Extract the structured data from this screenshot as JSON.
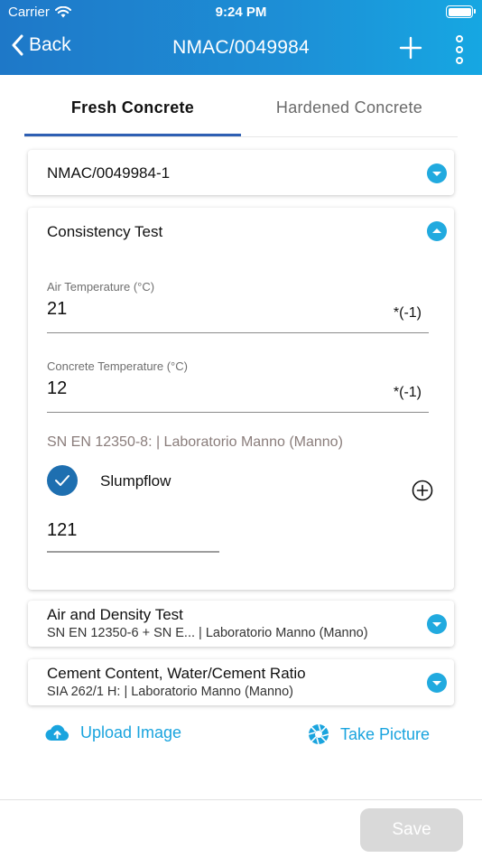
{
  "status_bar": {
    "carrier": "Carrier",
    "time": "9:24 PM"
  },
  "nav": {
    "back_label": "Back",
    "title": "NMAC/0049984"
  },
  "tabs": [
    {
      "label": "Fresh Concrete",
      "active": true
    },
    {
      "label": "Hardened Concrete",
      "active": false
    }
  ],
  "sample": {
    "label": "NMAC/0049984-1"
  },
  "consistency": {
    "title": "Consistency Test",
    "air_temp": {
      "label": "Air Temperature (°C)",
      "value": "21",
      "suffix": "*(-1)"
    },
    "concrete_temp": {
      "label": "Concrete Temperature (°C)",
      "value": "12",
      "suffix": "*(-1)"
    },
    "standard": "SN EN 12350-8: | Laboratorio Manno (Manno)",
    "slumpflow": {
      "label": "Slumpflow",
      "checked": true,
      "value": "121"
    }
  },
  "air_density": {
    "title": "Air and Density Test",
    "subtitle": "SN EN 12350-6 + SN E...  | Laboratorio Manno (Manno)"
  },
  "cement": {
    "title": "Cement Content, Water/Cement Ratio",
    "subtitle": "SIA 262/1 H: | Laboratorio Manno (Manno)"
  },
  "actions": {
    "upload_label": "Upload Image",
    "picture_label": "Take Picture"
  },
  "footer": {
    "save_label": "Save"
  },
  "colors": {
    "header_start": "#1e78c8",
    "header_end": "#16a7e2",
    "accent": "#21aadf",
    "tab_indicator": "#2e5fb3",
    "check": "#1e6fb0",
    "save_disabled": "#d9d9d9"
  }
}
